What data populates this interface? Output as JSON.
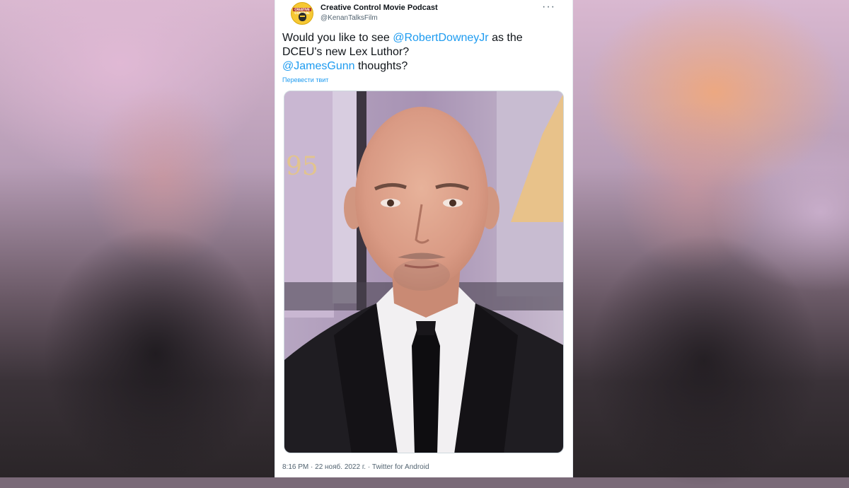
{
  "tweet": {
    "author_name": "Creative Control Movie Podcast",
    "author_handle": "@KenanTalksFilm",
    "avatar_text": "CREATIVE CONTROL",
    "text_part1": "Would you like to see ",
    "mention1": "@RobertDowneyJr",
    "text_part2": " as the DCEU's new Lex Luthor?",
    "mention2": "@JamesGunn",
    "text_part3": " thoughts?",
    "translate_label": "Перевести твит",
    "more_icon": "more-horizontal-icon",
    "footer_meta": "8:16 PM · 22 нояб. 2022 г. · Twitter for Android",
    "photo_backdrop_text": "95"
  },
  "colors": {
    "link": "#1d9bf0",
    "text": "#0f1419",
    "muted": "#536471"
  }
}
